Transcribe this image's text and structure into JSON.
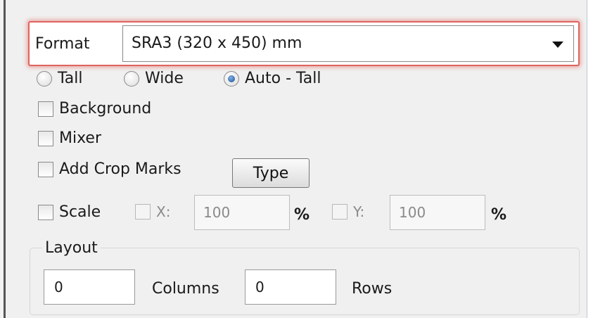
{
  "format": {
    "label": "Format",
    "selected": "SRA3 (320 x 450) mm"
  },
  "orientation": {
    "options": [
      {
        "label": "Tall",
        "checked": false
      },
      {
        "label": "Wide",
        "checked": false
      },
      {
        "label": "Auto - Tall",
        "checked": true
      }
    ]
  },
  "options": {
    "background": {
      "label": "Background",
      "checked": false
    },
    "mixer": {
      "label": "Mixer",
      "checked": false
    },
    "crop_marks": {
      "label": "Add Crop Marks",
      "checked": false
    },
    "type_button": "Type"
  },
  "scale": {
    "label": "Scale",
    "checked": false,
    "x": {
      "label": "X:",
      "value": "100",
      "unit": "%"
    },
    "y": {
      "label": "Y:",
      "value": "100",
      "unit": "%"
    }
  },
  "layout": {
    "title": "Layout",
    "columns": {
      "value": "0",
      "label": "Columns"
    },
    "rows": {
      "value": "0",
      "label": "Rows"
    }
  }
}
